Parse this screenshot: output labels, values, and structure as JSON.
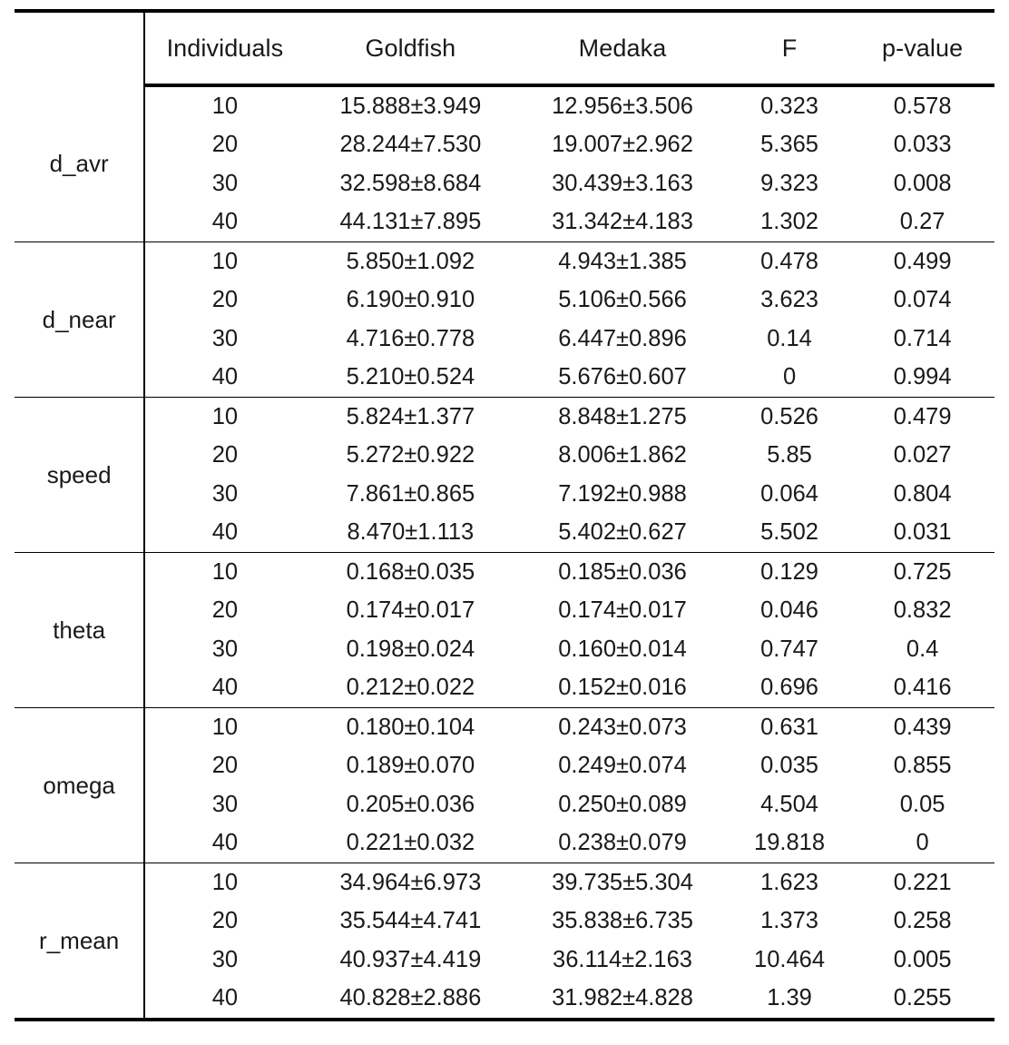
{
  "table": {
    "corner_label": "",
    "columns": [
      {
        "key": "individuals",
        "label": "Individuals"
      },
      {
        "key": "goldfish",
        "label": "Goldfish"
      },
      {
        "key": "medaka",
        "label": "Medaka"
      },
      {
        "key": "f",
        "label": "F"
      },
      {
        "key": "pvalue",
        "label": "p-value"
      }
    ],
    "groups": [
      {
        "label": "d_avr",
        "rows": [
          {
            "individuals": "10",
            "goldfish": "15.888±3.949",
            "medaka": "12.956±3.506",
            "f": "0.323",
            "pvalue": "0.578"
          },
          {
            "individuals": "20",
            "goldfish": "28.244±7.530",
            "medaka": "19.007±2.962",
            "f": "5.365",
            "pvalue": "0.033"
          },
          {
            "individuals": "30",
            "goldfish": "32.598±8.684",
            "medaka": "30.439±3.163",
            "f": "9.323",
            "pvalue": "0.008"
          },
          {
            "individuals": "40",
            "goldfish": "44.131±7.895",
            "medaka": "31.342±4.183",
            "f": "1.302",
            "pvalue": "0.27"
          }
        ]
      },
      {
        "label": "d_near",
        "rows": [
          {
            "individuals": "10",
            "goldfish": "5.850±1.092",
            "medaka": "4.943±1.385",
            "f": "0.478",
            "pvalue": "0.499"
          },
          {
            "individuals": "20",
            "goldfish": "6.190±0.910",
            "medaka": "5.106±0.566",
            "f": "3.623",
            "pvalue": "0.074"
          },
          {
            "individuals": "30",
            "goldfish": "4.716±0.778",
            "medaka": "6.447±0.896",
            "f": "0.14",
            "pvalue": "0.714"
          },
          {
            "individuals": "40",
            "goldfish": "5.210±0.524",
            "medaka": "5.676±0.607",
            "f": "0",
            "pvalue": "0.994"
          }
        ]
      },
      {
        "label": "speed",
        "rows": [
          {
            "individuals": "10",
            "goldfish": "5.824±1.377",
            "medaka": "8.848±1.275",
            "f": "0.526",
            "pvalue": "0.479"
          },
          {
            "individuals": "20",
            "goldfish": "5.272±0.922",
            "medaka": "8.006±1.862",
            "f": "5.85",
            "pvalue": "0.027"
          },
          {
            "individuals": "30",
            "goldfish": "7.861±0.865",
            "medaka": "7.192±0.988",
            "f": "0.064",
            "pvalue": "0.804"
          },
          {
            "individuals": "40",
            "goldfish": "8.470±1.113",
            "medaka": "5.402±0.627",
            "f": "5.502",
            "pvalue": "0.031"
          }
        ]
      },
      {
        "label": "theta",
        "rows": [
          {
            "individuals": "10",
            "goldfish": "0.168±0.035",
            "medaka": "0.185±0.036",
            "f": "0.129",
            "pvalue": "0.725"
          },
          {
            "individuals": "20",
            "goldfish": "0.174±0.017",
            "medaka": "0.174±0.017",
            "f": "0.046",
            "pvalue": "0.832"
          },
          {
            "individuals": "30",
            "goldfish": "0.198±0.024",
            "medaka": "0.160±0.014",
            "f": "0.747",
            "pvalue": "0.4"
          },
          {
            "individuals": "40",
            "goldfish": "0.212±0.022",
            "medaka": "0.152±0.016",
            "f": "0.696",
            "pvalue": "0.416"
          }
        ]
      },
      {
        "label": "omega",
        "rows": [
          {
            "individuals": "10",
            "goldfish": "0.180±0.104",
            "medaka": "0.243±0.073",
            "f": "0.631",
            "pvalue": "0.439"
          },
          {
            "individuals": "20",
            "goldfish": "0.189±0.070",
            "medaka": "0.249±0.074",
            "f": "0.035",
            "pvalue": "0.855"
          },
          {
            "individuals": "30",
            "goldfish": "0.205±0.036",
            "medaka": "0.250±0.089",
            "f": "4.504",
            "pvalue": "0.05"
          },
          {
            "individuals": "40",
            "goldfish": "0.221±0.032",
            "medaka": "0.238±0.079",
            "f": "19.818",
            "pvalue": "0"
          }
        ]
      },
      {
        "label": "r_mean",
        "rows": [
          {
            "individuals": "10",
            "goldfish": "34.964±6.973",
            "medaka": "39.735±5.304",
            "f": "1.623",
            "pvalue": "0.221"
          },
          {
            "individuals": "20",
            "goldfish": "35.544±4.741",
            "medaka": "35.838±6.735",
            "f": "1.373",
            "pvalue": "0.258"
          },
          {
            "individuals": "30",
            "goldfish": "40.937±4.419",
            "medaka": "36.114±2.163",
            "f": "10.464",
            "pvalue": "0.005"
          },
          {
            "individuals": "40",
            "goldfish": "40.828±2.886",
            "medaka": "31.982±4.828",
            "f": "1.39",
            "pvalue": "0.255"
          }
        ]
      }
    ]
  },
  "style": {
    "text_color": "#1a1a1a",
    "rule_color": "#000000",
    "background": "#ffffff"
  }
}
